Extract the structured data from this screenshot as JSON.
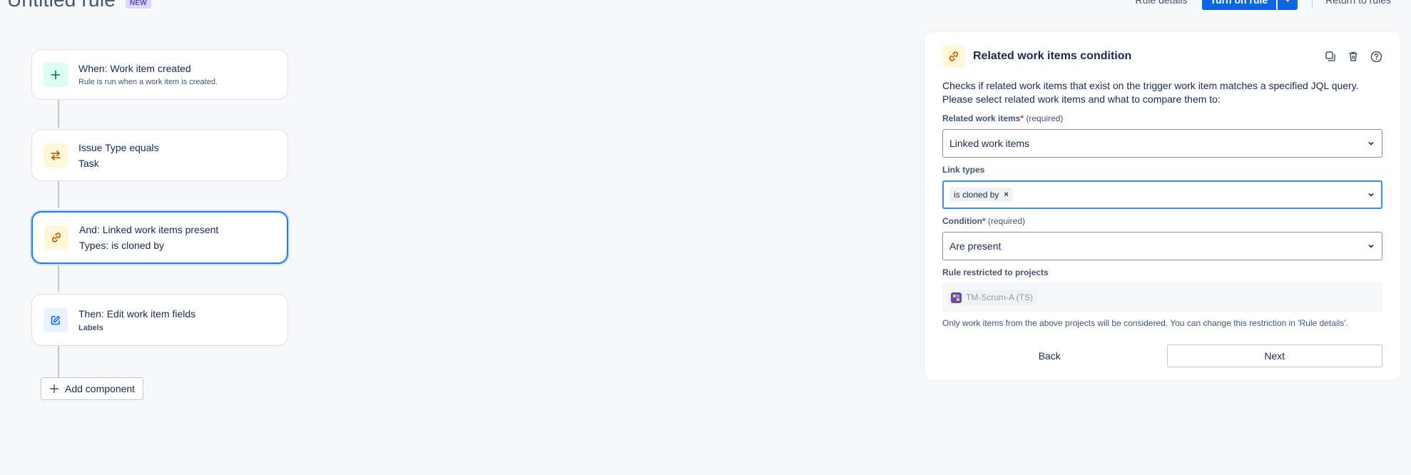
{
  "header": {
    "title": "Untitled rule",
    "badge": "NEW",
    "rule_details": "Rule details",
    "turn_on": "Turn on rule",
    "return_to_rules": "Return to rules"
  },
  "flow": {
    "steps": [
      {
        "title": "When: Work item created",
        "subtitle": "Rule is run when a work item is created.",
        "icon": "plus-icon"
      },
      {
        "title": "Issue Type equals",
        "subtitle": "Task",
        "icon": "swap-arrows-icon"
      },
      {
        "title": "And: Linked work items present",
        "subtitle": "Types: is cloned by",
        "icon": "link-icon"
      },
      {
        "title": "Then: Edit work item fields",
        "subtitle": "Labels",
        "icon": "edit-icon"
      }
    ],
    "add_component": "Add component"
  },
  "panel": {
    "title": "Related work items condition",
    "description": "Checks if related work items that exist on the trigger work item matches a specified JQL query. Please select related work items and what to compare them to:",
    "related_label": "Related work items",
    "required_marker": "*",
    "required_text": "(required)",
    "related_value": "Linked work items",
    "link_types_label": "Link types",
    "link_type_tag": "is cloned by",
    "tag_remove": "×",
    "condition_label": "Condition",
    "condition_value": "Are present",
    "restricted_label": "Rule restricted to projects",
    "project": "TM-Scrum-A (TS)",
    "help_text": "Only work items from the above projects will be considered. You can change this restriction in 'Rule details'.",
    "back": "Back",
    "next": "Next"
  },
  "colors": {
    "primary": "#0c66e4",
    "focus": "#388bff",
    "required": "#c9372c",
    "link_icon": "#c25100",
    "trigger_icon": "#1f845a",
    "action_icon": "#0c66e4"
  }
}
